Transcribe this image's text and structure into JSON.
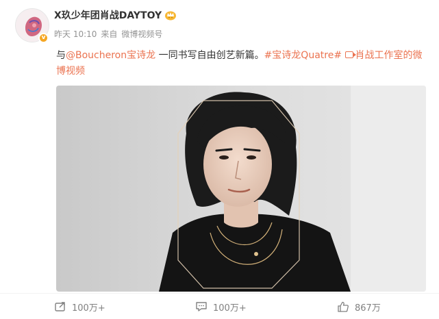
{
  "post": {
    "username": "X玖少年团肖战DAYTOY",
    "member_badge_icon": "crown-badge-icon",
    "verified_badge": "v",
    "timestamp": "昨天 10:10",
    "source_prefix": "来自",
    "source": "微博视频号",
    "content": {
      "prefix": "与",
      "mention": "@Boucheron宝诗龙",
      "middle": " 一同书写自由创艺新篇。",
      "hashtag": "#宝诗龙Quatre#",
      "video_link": "肖战工作室的微博视频"
    }
  },
  "actions": {
    "repost_count": "100万+",
    "comment_count": "100万+",
    "like_count": "867万"
  },
  "colors": {
    "link": "#eb7350",
    "meta": "#939393",
    "action": "#808080"
  }
}
